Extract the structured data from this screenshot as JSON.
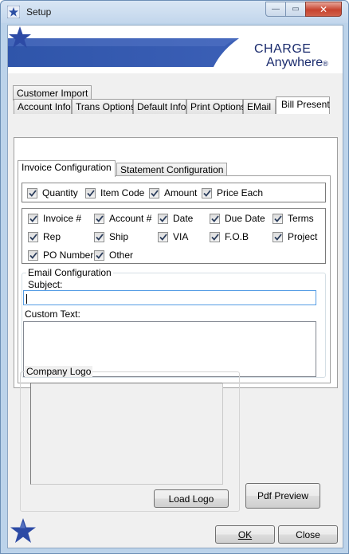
{
  "window": {
    "title": "Setup",
    "title_icon": "star-app-icon",
    "controls": {
      "minimize": "—",
      "maximize": "▭",
      "close": "✕"
    }
  },
  "banner": {
    "logo_line1": "CHARGE",
    "logo_line2": "Anywhere",
    "logo_mark": "®",
    "colors": {
      "brand_blue": "#1a2b6d",
      "stripe": "#3456a8"
    }
  },
  "tabs": {
    "row_back": [
      {
        "label": "Customer Import"
      }
    ],
    "row_front": [
      {
        "label": "Account Info"
      },
      {
        "label": "Trans Options"
      },
      {
        "label": "Default Info"
      },
      {
        "label": "Print Options"
      },
      {
        "label": "EMail"
      },
      {
        "label": "Bill Present",
        "active": true
      }
    ]
  },
  "subtabs": [
    {
      "label": "Invoice Configuration",
      "active": true
    },
    {
      "label": "Statement Configuration"
    }
  ],
  "line_items": [
    {
      "label": "Quantity",
      "checked": true
    },
    {
      "label": "Item Code",
      "checked": true
    },
    {
      "label": "Amount",
      "checked": true
    },
    {
      "label": "Price Each",
      "checked": true
    }
  ],
  "header_fields": [
    {
      "label": "Invoice #",
      "checked": true
    },
    {
      "label": "Account #",
      "checked": true
    },
    {
      "label": "Date",
      "checked": true
    },
    {
      "label": "Due Date",
      "checked": true
    },
    {
      "label": "Terms",
      "checked": true
    },
    {
      "label": "Rep",
      "checked": true
    },
    {
      "label": "Ship",
      "checked": true
    },
    {
      "label": "VIA",
      "checked": true
    },
    {
      "label": "F.O.B",
      "checked": true
    },
    {
      "label": "Project",
      "checked": true
    },
    {
      "label": "PO Number",
      "checked": true
    },
    {
      "label": "Other",
      "checked": true
    }
  ],
  "email_config": {
    "group_label": "Email Configuration",
    "subject_label": "Subject:",
    "subject_value": "",
    "custom_text_label": "Custom Text:",
    "custom_text_value": ""
  },
  "company_logo": {
    "group_label": "Company Logo",
    "load_button": "Load Logo"
  },
  "pdf_preview_button": "Pdf Preview",
  "footer": {
    "ok_button": "OK",
    "close_button": "Close",
    "star_icon": "star-logo-icon"
  }
}
